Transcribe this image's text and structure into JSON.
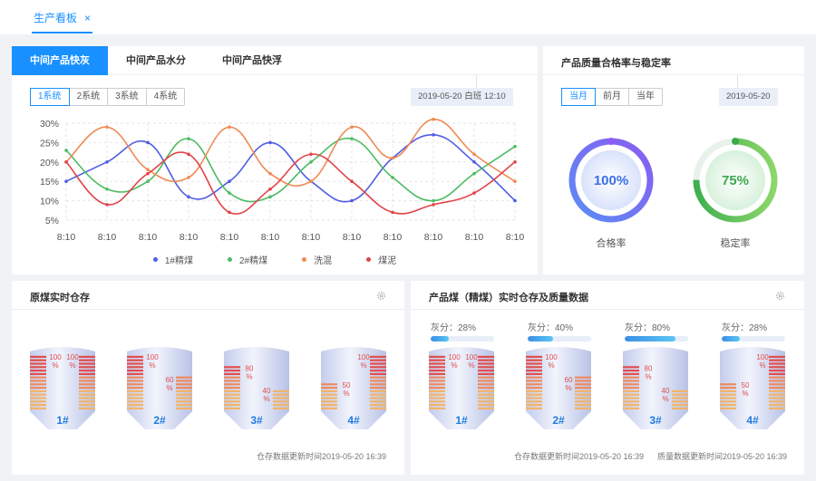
{
  "page_tab": {
    "label": "生产看板",
    "close": "×"
  },
  "left_chart_card": {
    "tabs": [
      "中间产品快灰",
      "中间产品水分",
      "中间产品快浮"
    ],
    "systems": [
      "1系统",
      "2系统",
      "3系统",
      "4系统"
    ],
    "date": "2019-05-20  白班  12:10"
  },
  "quality_card": {
    "title": "产品质量合格率与稳定率",
    "periods": [
      "当月",
      "前月",
      "当年"
    ],
    "date": "2019-05-20",
    "pass_rate": {
      "value": "100%",
      "label": "合格率",
      "fraction": 1.0
    },
    "stability_rate": {
      "value": "75%",
      "label": "稳定率",
      "fraction": 0.75
    }
  },
  "raw_coal_card": {
    "title": "原煤实时仓存",
    "footer": "仓存数据更新时间2019-05-20  16:39",
    "silos": [
      {
        "name": "1#",
        "left": "100",
        "right": "100",
        "left_level": 1.0,
        "right_level": 1.0
      },
      {
        "name": "2#",
        "left": "100",
        "right": "60",
        "left_level": 1.0,
        "right_level": 0.6
      },
      {
        "name": "3#",
        "left": "80",
        "right": "40",
        "left_level": 0.8,
        "right_level": 0.4
      },
      {
        "name": "4#",
        "left": "50",
        "right": "100",
        "left_level": 0.5,
        "right_level": 1.0
      }
    ]
  },
  "product_coal_card": {
    "title": "产品煤（精煤）实时仓存及质量数据",
    "footer_left": "仓存数据更新时间2019-05-20  16:39",
    "footer_right": "质量数据更新时间2019-05-20  16:39",
    "ash_label": "灰分：",
    "silos": [
      {
        "name": "1#",
        "ash": "28%",
        "ash_fraction": 0.28,
        "left": "100",
        "right": "100",
        "left_level": 1.0,
        "right_level": 1.0
      },
      {
        "name": "2#",
        "ash": "40%",
        "ash_fraction": 0.4,
        "left": "100",
        "right": "60",
        "left_level": 1.0,
        "right_level": 0.6
      },
      {
        "name": "3#",
        "ash": "80%",
        "ash_fraction": 0.8,
        "left": "80",
        "right": "40",
        "left_level": 0.8,
        "right_level": 0.4
      },
      {
        "name": "4#",
        "ash": "28%",
        "ash_fraction": 0.28,
        "left": "50",
        "right": "100",
        "left_level": 0.5,
        "right_level": 1.0
      }
    ]
  },
  "percent_sign": "%",
  "colors": {
    "accent": "#1890ff",
    "blue": "#4f5de4",
    "green": "#4dbb63",
    "orange": "#ef8a55",
    "red": "#e2434a"
  },
  "chart_data": {
    "type": "line",
    "categories": [
      "8:10",
      "8:10",
      "8:10",
      "8:10",
      "8:10",
      "8:10",
      "8:10",
      "8:10",
      "8:10",
      "8:10",
      "8:10",
      "8:10"
    ],
    "y_ticks": [
      "30%",
      "25%",
      "20%",
      "15%",
      "10%",
      "5%"
    ],
    "ylim": [
      5,
      30
    ],
    "grid": true,
    "legend_position": "bottom",
    "series": [
      {
        "name": "1#精煤",
        "color": "#4f5de4",
        "values": [
          15,
          20,
          25,
          11,
          15,
          25,
          15,
          10,
          21,
          27,
          20,
          10
        ]
      },
      {
        "name": "2#精煤",
        "color": "#4dbb63",
        "values": [
          23,
          13,
          15,
          26,
          12,
          11,
          20,
          26,
          16,
          10,
          17,
          24
        ]
      },
      {
        "name": "洗混",
        "color": "#ef8a55",
        "values": [
          20,
          29,
          18,
          16,
          29,
          17,
          15,
          29,
          21,
          31,
          22,
          15
        ]
      },
      {
        "name": "煤泥",
        "color": "#e2434a",
        "values": [
          20,
          9,
          17,
          22,
          7,
          13,
          22,
          15,
          7,
          9,
          12,
          20
        ]
      }
    ]
  }
}
